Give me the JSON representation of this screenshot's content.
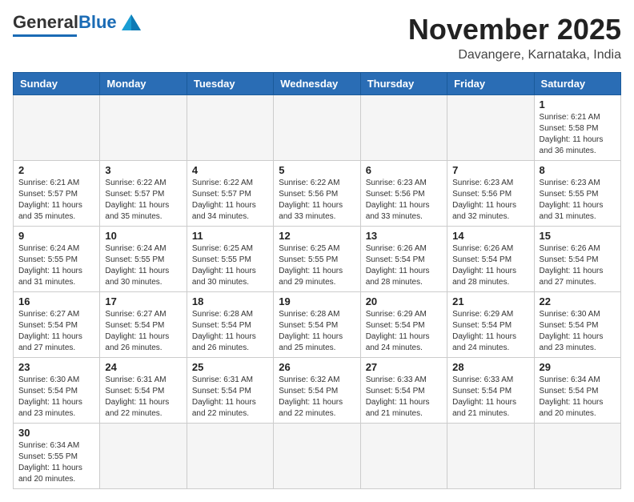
{
  "header": {
    "logo_text_general": "General",
    "logo_text_blue": "Blue",
    "main_title": "November 2025",
    "subtitle": "Davangere, Karnataka, India"
  },
  "calendar": {
    "days_of_week": [
      "Sunday",
      "Monday",
      "Tuesday",
      "Wednesday",
      "Thursday",
      "Friday",
      "Saturday"
    ],
    "weeks": [
      [
        {
          "day": "",
          "info": ""
        },
        {
          "day": "",
          "info": ""
        },
        {
          "day": "",
          "info": ""
        },
        {
          "day": "",
          "info": ""
        },
        {
          "day": "",
          "info": ""
        },
        {
          "day": "",
          "info": ""
        },
        {
          "day": "1",
          "info": "Sunrise: 6:21 AM\nSunset: 5:58 PM\nDaylight: 11 hours and 36 minutes."
        }
      ],
      [
        {
          "day": "2",
          "info": "Sunrise: 6:21 AM\nSunset: 5:57 PM\nDaylight: 11 hours and 35 minutes."
        },
        {
          "day": "3",
          "info": "Sunrise: 6:22 AM\nSunset: 5:57 PM\nDaylight: 11 hours and 35 minutes."
        },
        {
          "day": "4",
          "info": "Sunrise: 6:22 AM\nSunset: 5:57 PM\nDaylight: 11 hours and 34 minutes."
        },
        {
          "day": "5",
          "info": "Sunrise: 6:22 AM\nSunset: 5:56 PM\nDaylight: 11 hours and 33 minutes."
        },
        {
          "day": "6",
          "info": "Sunrise: 6:23 AM\nSunset: 5:56 PM\nDaylight: 11 hours and 33 minutes."
        },
        {
          "day": "7",
          "info": "Sunrise: 6:23 AM\nSunset: 5:56 PM\nDaylight: 11 hours and 32 minutes."
        },
        {
          "day": "8",
          "info": "Sunrise: 6:23 AM\nSunset: 5:55 PM\nDaylight: 11 hours and 31 minutes."
        }
      ],
      [
        {
          "day": "9",
          "info": "Sunrise: 6:24 AM\nSunset: 5:55 PM\nDaylight: 11 hours and 31 minutes."
        },
        {
          "day": "10",
          "info": "Sunrise: 6:24 AM\nSunset: 5:55 PM\nDaylight: 11 hours and 30 minutes."
        },
        {
          "day": "11",
          "info": "Sunrise: 6:25 AM\nSunset: 5:55 PM\nDaylight: 11 hours and 30 minutes."
        },
        {
          "day": "12",
          "info": "Sunrise: 6:25 AM\nSunset: 5:55 PM\nDaylight: 11 hours and 29 minutes."
        },
        {
          "day": "13",
          "info": "Sunrise: 6:26 AM\nSunset: 5:54 PM\nDaylight: 11 hours and 28 minutes."
        },
        {
          "day": "14",
          "info": "Sunrise: 6:26 AM\nSunset: 5:54 PM\nDaylight: 11 hours and 28 minutes."
        },
        {
          "day": "15",
          "info": "Sunrise: 6:26 AM\nSunset: 5:54 PM\nDaylight: 11 hours and 27 minutes."
        }
      ],
      [
        {
          "day": "16",
          "info": "Sunrise: 6:27 AM\nSunset: 5:54 PM\nDaylight: 11 hours and 27 minutes."
        },
        {
          "day": "17",
          "info": "Sunrise: 6:27 AM\nSunset: 5:54 PM\nDaylight: 11 hours and 26 minutes."
        },
        {
          "day": "18",
          "info": "Sunrise: 6:28 AM\nSunset: 5:54 PM\nDaylight: 11 hours and 26 minutes."
        },
        {
          "day": "19",
          "info": "Sunrise: 6:28 AM\nSunset: 5:54 PM\nDaylight: 11 hours and 25 minutes."
        },
        {
          "day": "20",
          "info": "Sunrise: 6:29 AM\nSunset: 5:54 PM\nDaylight: 11 hours and 24 minutes."
        },
        {
          "day": "21",
          "info": "Sunrise: 6:29 AM\nSunset: 5:54 PM\nDaylight: 11 hours and 24 minutes."
        },
        {
          "day": "22",
          "info": "Sunrise: 6:30 AM\nSunset: 5:54 PM\nDaylight: 11 hours and 23 minutes."
        }
      ],
      [
        {
          "day": "23",
          "info": "Sunrise: 6:30 AM\nSunset: 5:54 PM\nDaylight: 11 hours and 23 minutes."
        },
        {
          "day": "24",
          "info": "Sunrise: 6:31 AM\nSunset: 5:54 PM\nDaylight: 11 hours and 22 minutes."
        },
        {
          "day": "25",
          "info": "Sunrise: 6:31 AM\nSunset: 5:54 PM\nDaylight: 11 hours and 22 minutes."
        },
        {
          "day": "26",
          "info": "Sunrise: 6:32 AM\nSunset: 5:54 PM\nDaylight: 11 hours and 22 minutes."
        },
        {
          "day": "27",
          "info": "Sunrise: 6:33 AM\nSunset: 5:54 PM\nDaylight: 11 hours and 21 minutes."
        },
        {
          "day": "28",
          "info": "Sunrise: 6:33 AM\nSunset: 5:54 PM\nDaylight: 11 hours and 21 minutes."
        },
        {
          "day": "29",
          "info": "Sunrise: 6:34 AM\nSunset: 5:54 PM\nDaylight: 11 hours and 20 minutes."
        }
      ],
      [
        {
          "day": "30",
          "info": "Sunrise: 6:34 AM\nSunset: 5:55 PM\nDaylight: 11 hours and 20 minutes."
        },
        {
          "day": "",
          "info": ""
        },
        {
          "day": "",
          "info": ""
        },
        {
          "day": "",
          "info": ""
        },
        {
          "day": "",
          "info": ""
        },
        {
          "day": "",
          "info": ""
        },
        {
          "day": "",
          "info": ""
        }
      ]
    ]
  }
}
